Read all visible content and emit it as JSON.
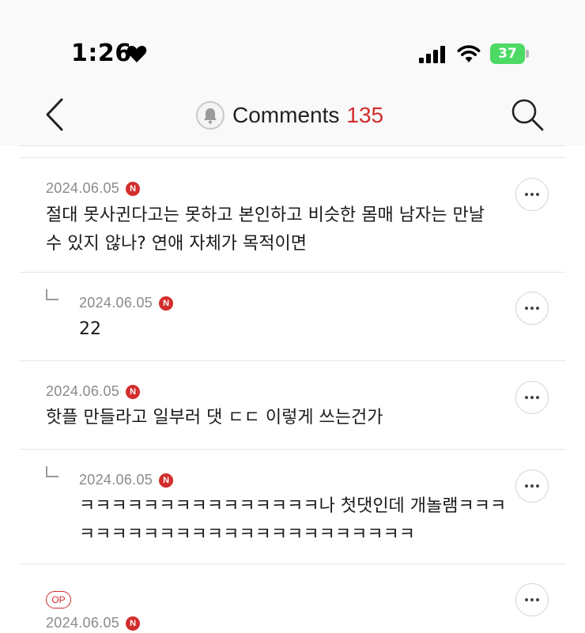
{
  "status_bar": {
    "time": "1:26",
    "battery_level": "37",
    "icons": [
      "heart-icon",
      "signal-icon",
      "wifi-icon",
      "battery-icon"
    ]
  },
  "header": {
    "title": "Comments",
    "count": "135",
    "icons": [
      "back-chevron-icon",
      "bell-icon",
      "search-icon"
    ]
  },
  "colors": {
    "accent": "#d32d2d",
    "battery": "#4cd964",
    "date_text": "#8a8a8a"
  },
  "comments": [
    {
      "date": "2024.06.05",
      "badge": "N",
      "text": "절대 못사귄다고는 못하고 본인하고 비슷한 몸매 남자는 만날 수 있지 않나? 연애 자체가 목적이면",
      "reply": false
    },
    {
      "date": "2024.06.05",
      "badge": "N",
      "text": "22",
      "reply": true
    },
    {
      "date": "2024.06.05",
      "badge": "N",
      "text": "핫플 만들라고 일부러 댓 ㄷㄷ 이렇게 쓰는건가",
      "reply": false
    },
    {
      "date": "2024.06.05",
      "badge": "N",
      "text": "ㅋㅋㅋㅋㅋㅋㅋㅋㅋㅋㅋㅋㅋㅋㅋ나 첫댓인데 개놀램ㅋㅋㅋㅋㅋㅋㅋㅋㅋㅋㅋㅋㅋㅋㅋㅋㅋㅋㅋㅋㅋㅋㅋㅋ",
      "reply": true
    },
    {
      "op_label": "OP",
      "date": "2024.06.05",
      "badge": "N",
      "reply": false
    }
  ]
}
